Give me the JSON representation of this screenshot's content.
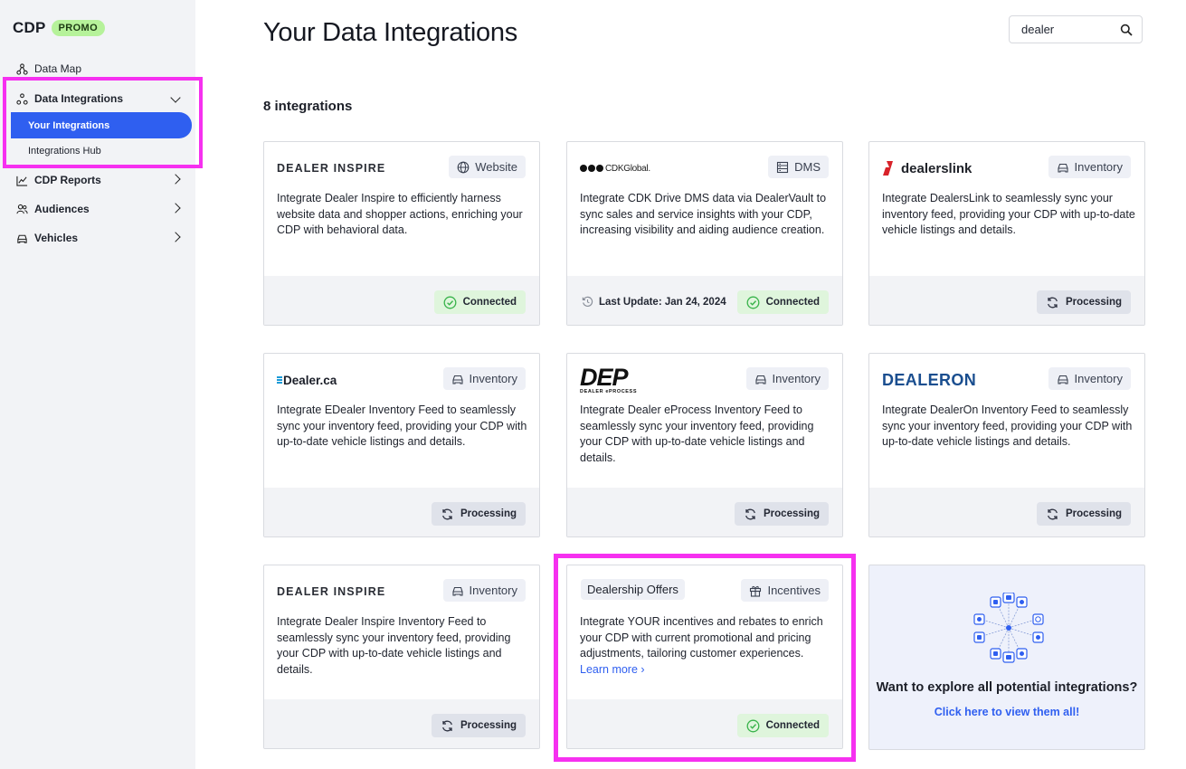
{
  "brand": {
    "name": "CDP",
    "badge": "PROMO"
  },
  "sidebar": {
    "items": [
      {
        "label": "Data Map"
      },
      {
        "label": "Data Integrations"
      },
      {
        "label": "Your Integrations"
      },
      {
        "label": "Integrations Hub"
      },
      {
        "label": "CDP Reports"
      },
      {
        "label": "Audiences"
      },
      {
        "label": "Vehicles"
      }
    ]
  },
  "header": {
    "title": "Your Data Integrations"
  },
  "search": {
    "value": "dealer"
  },
  "summary": {
    "count_label": "8 integrations"
  },
  "colors": {
    "accent": "#2f5ff0",
    "highlight": "#f630f0",
    "badge": "#b6f29a",
    "connected": "#dff5dc",
    "processing": "#dfe2ea"
  },
  "cards": [
    {
      "logo": "DEALER INSPIRE",
      "tag": "Website",
      "tag_icon": "globe-icon",
      "desc": "Integrate Dealer Inspire to efficiently harness website data and shopper actions, enriching your CDP with behavioral data.",
      "status": "Connected"
    },
    {
      "logo": "CDKGlobal.",
      "tag": "DMS",
      "tag_icon": "server-icon",
      "desc": "Integrate CDK Drive DMS data via DealerVault to sync sales and service insights with your CDP, increasing visibility and aiding audience creation.",
      "last_update": "Last Update: Jan 24, 2024",
      "status": "Connected"
    },
    {
      "logo": "dealerslink",
      "tag": "Inventory",
      "tag_icon": "car-icon",
      "desc": "Integrate DealersLink to seamlessly sync your inventory feed, providing your CDP with up-to-date vehicle listings and details.",
      "status": "Processing"
    },
    {
      "logo": "Dealer.ca",
      "tag": "Inventory",
      "tag_icon": "car-icon",
      "desc": "Integrate EDealer Inventory Feed to seamlessly sync your inventory feed, providing your CDP with up-to-date vehicle listings and details.",
      "status": "Processing"
    },
    {
      "logo": "DEP",
      "logo_sub": "DEALER ePROCESS",
      "tag": "Inventory",
      "tag_icon": "car-icon",
      "desc": "Integrate Dealer eProcess Inventory Feed to seamlessly sync your inventory feed, providing your CDP with up-to-date vehicle listings and details.",
      "status": "Processing"
    },
    {
      "logo": "DEALERON",
      "tag": "Inventory",
      "tag_icon": "car-icon",
      "desc": "Integrate DealerOn Inventory Feed to seamlessly sync your inventory feed, providing your CDP with up-to-date vehicle listings and details.",
      "status": "Processing"
    },
    {
      "logo": "DEALER INSPIRE",
      "tag": "Inventory",
      "tag_icon": "car-icon",
      "desc": "Integrate Dealer Inspire Inventory Feed to seamlessly sync your inventory feed, providing your CDP with up-to-date vehicle listings and details.",
      "status": "Processing"
    },
    {
      "logo": "Dealership Offers",
      "tag": "Incentives",
      "tag_icon": "gift-icon",
      "desc": "Integrate YOUR incentives and rebates to enrich your CDP with current promotional and pricing adjustments, tailoring customer experiences.",
      "learn_more": "Learn more ›",
      "status": "Connected"
    }
  ],
  "explore": {
    "question": "Want to explore all potential integrations?",
    "link": "Click here to view them all!"
  }
}
